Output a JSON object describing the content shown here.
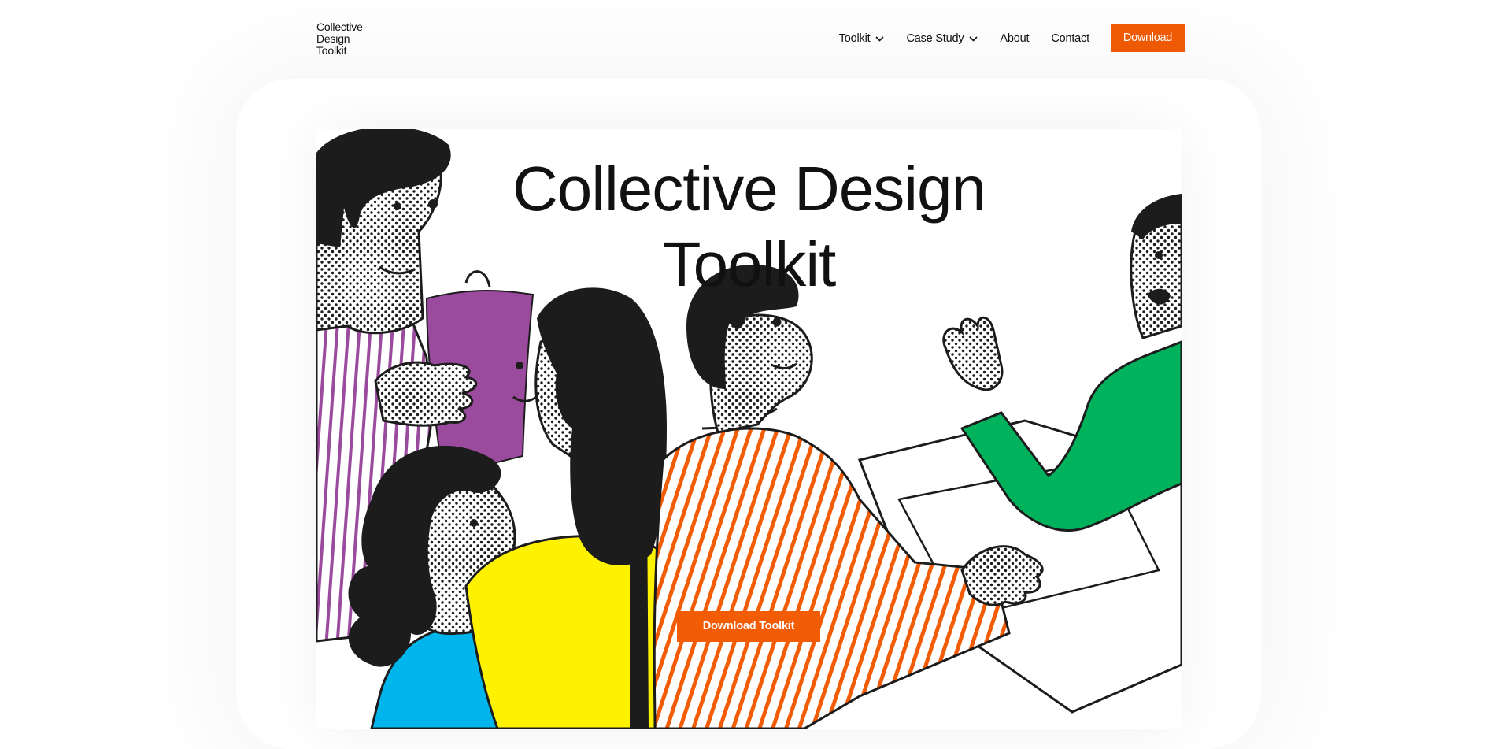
{
  "logo": {
    "lines": [
      "Collective",
      "Design",
      "Toolkit"
    ]
  },
  "nav": {
    "items": [
      {
        "label": "Toolkit",
        "has_dropdown": true
      },
      {
        "label": "Case Study",
        "has_dropdown": true
      },
      {
        "label": "About",
        "has_dropdown": false
      },
      {
        "label": "Contact",
        "has_dropdown": false
      }
    ],
    "download_label": "Download"
  },
  "hero": {
    "title_lines": [
      "Collective Design",
      "Toolkit"
    ],
    "button_label": "Download Toolkit",
    "illustration": "collaborating-people-illustration"
  },
  "colors": {
    "accent": "#f25c05",
    "purple": "#9b4b9e",
    "yellow": "#fff200",
    "green": "#00b25c",
    "blue": "#00b4ec",
    "orange_stripe": "#f25c05",
    "ink": "#1c1c1c"
  }
}
